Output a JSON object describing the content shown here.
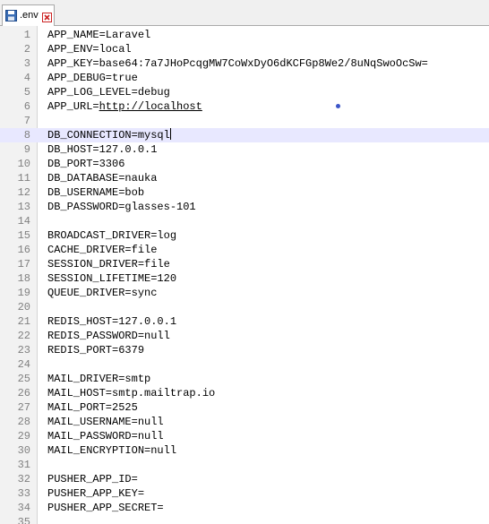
{
  "tab": {
    "title": ".env",
    "save_icon": "floppy-disk-icon",
    "close_icon": "close-icon"
  },
  "editor": {
    "current_line": 8,
    "lines": [
      {
        "number": "1",
        "text": "APP_NAME=Laravel"
      },
      {
        "number": "2",
        "text": "APP_ENV=local"
      },
      {
        "number": "3",
        "text": "APP_KEY=base64:7a7JHoPcqgMW7CoWxDyO6dKCFGp8We2/8uNqSwoOcSw="
      },
      {
        "number": "4",
        "text": "APP_DEBUG=true"
      },
      {
        "number": "5",
        "text": "APP_LOG_LEVEL=debug"
      },
      {
        "number": "6",
        "text": "APP_URL=",
        "link": "http://localhost"
      },
      {
        "number": "7",
        "text": ""
      },
      {
        "number": "8",
        "text": "DB_CONNECTION=mysql"
      },
      {
        "number": "9",
        "text": "DB_HOST=127.0.0.1"
      },
      {
        "number": "10",
        "text": "DB_PORT=3306"
      },
      {
        "number": "11",
        "text": "DB_DATABASE=nauka"
      },
      {
        "number": "12",
        "text": "DB_USERNAME=bob"
      },
      {
        "number": "13",
        "text": "DB_PASSWORD=glasses-101"
      },
      {
        "number": "14",
        "text": ""
      },
      {
        "number": "15",
        "text": "BROADCAST_DRIVER=log"
      },
      {
        "number": "16",
        "text": "CACHE_DRIVER=file"
      },
      {
        "number": "17",
        "text": "SESSION_DRIVER=file"
      },
      {
        "number": "18",
        "text": "SESSION_LIFETIME=120"
      },
      {
        "number": "19",
        "text": "QUEUE_DRIVER=sync"
      },
      {
        "number": "20",
        "text": ""
      },
      {
        "number": "21",
        "text": "REDIS_HOST=127.0.0.1"
      },
      {
        "number": "22",
        "text": "REDIS_PASSWORD=null"
      },
      {
        "number": "23",
        "text": "REDIS_PORT=6379"
      },
      {
        "number": "24",
        "text": ""
      },
      {
        "number": "25",
        "text": "MAIL_DRIVER=smtp"
      },
      {
        "number": "26",
        "text": "MAIL_HOST=smtp.mailtrap.io"
      },
      {
        "number": "27",
        "text": "MAIL_PORT=2525"
      },
      {
        "number": "28",
        "text": "MAIL_USERNAME=null"
      },
      {
        "number": "29",
        "text": "MAIL_PASSWORD=null"
      },
      {
        "number": "30",
        "text": "MAIL_ENCRYPTION=null"
      },
      {
        "number": "31",
        "text": ""
      },
      {
        "number": "32",
        "text": "PUSHER_APP_ID="
      },
      {
        "number": "33",
        "text": "PUSHER_APP_KEY="
      },
      {
        "number": "34",
        "text": "PUSHER_APP_SECRET="
      },
      {
        "number": "35",
        "text": ""
      }
    ]
  },
  "colors": {
    "current_line": "#e8e8ff",
    "gutter": "#f2f2f2",
    "line_number": "#808080",
    "close_icon": "#cc2222",
    "mouse_dot": "#3b55c8"
  }
}
